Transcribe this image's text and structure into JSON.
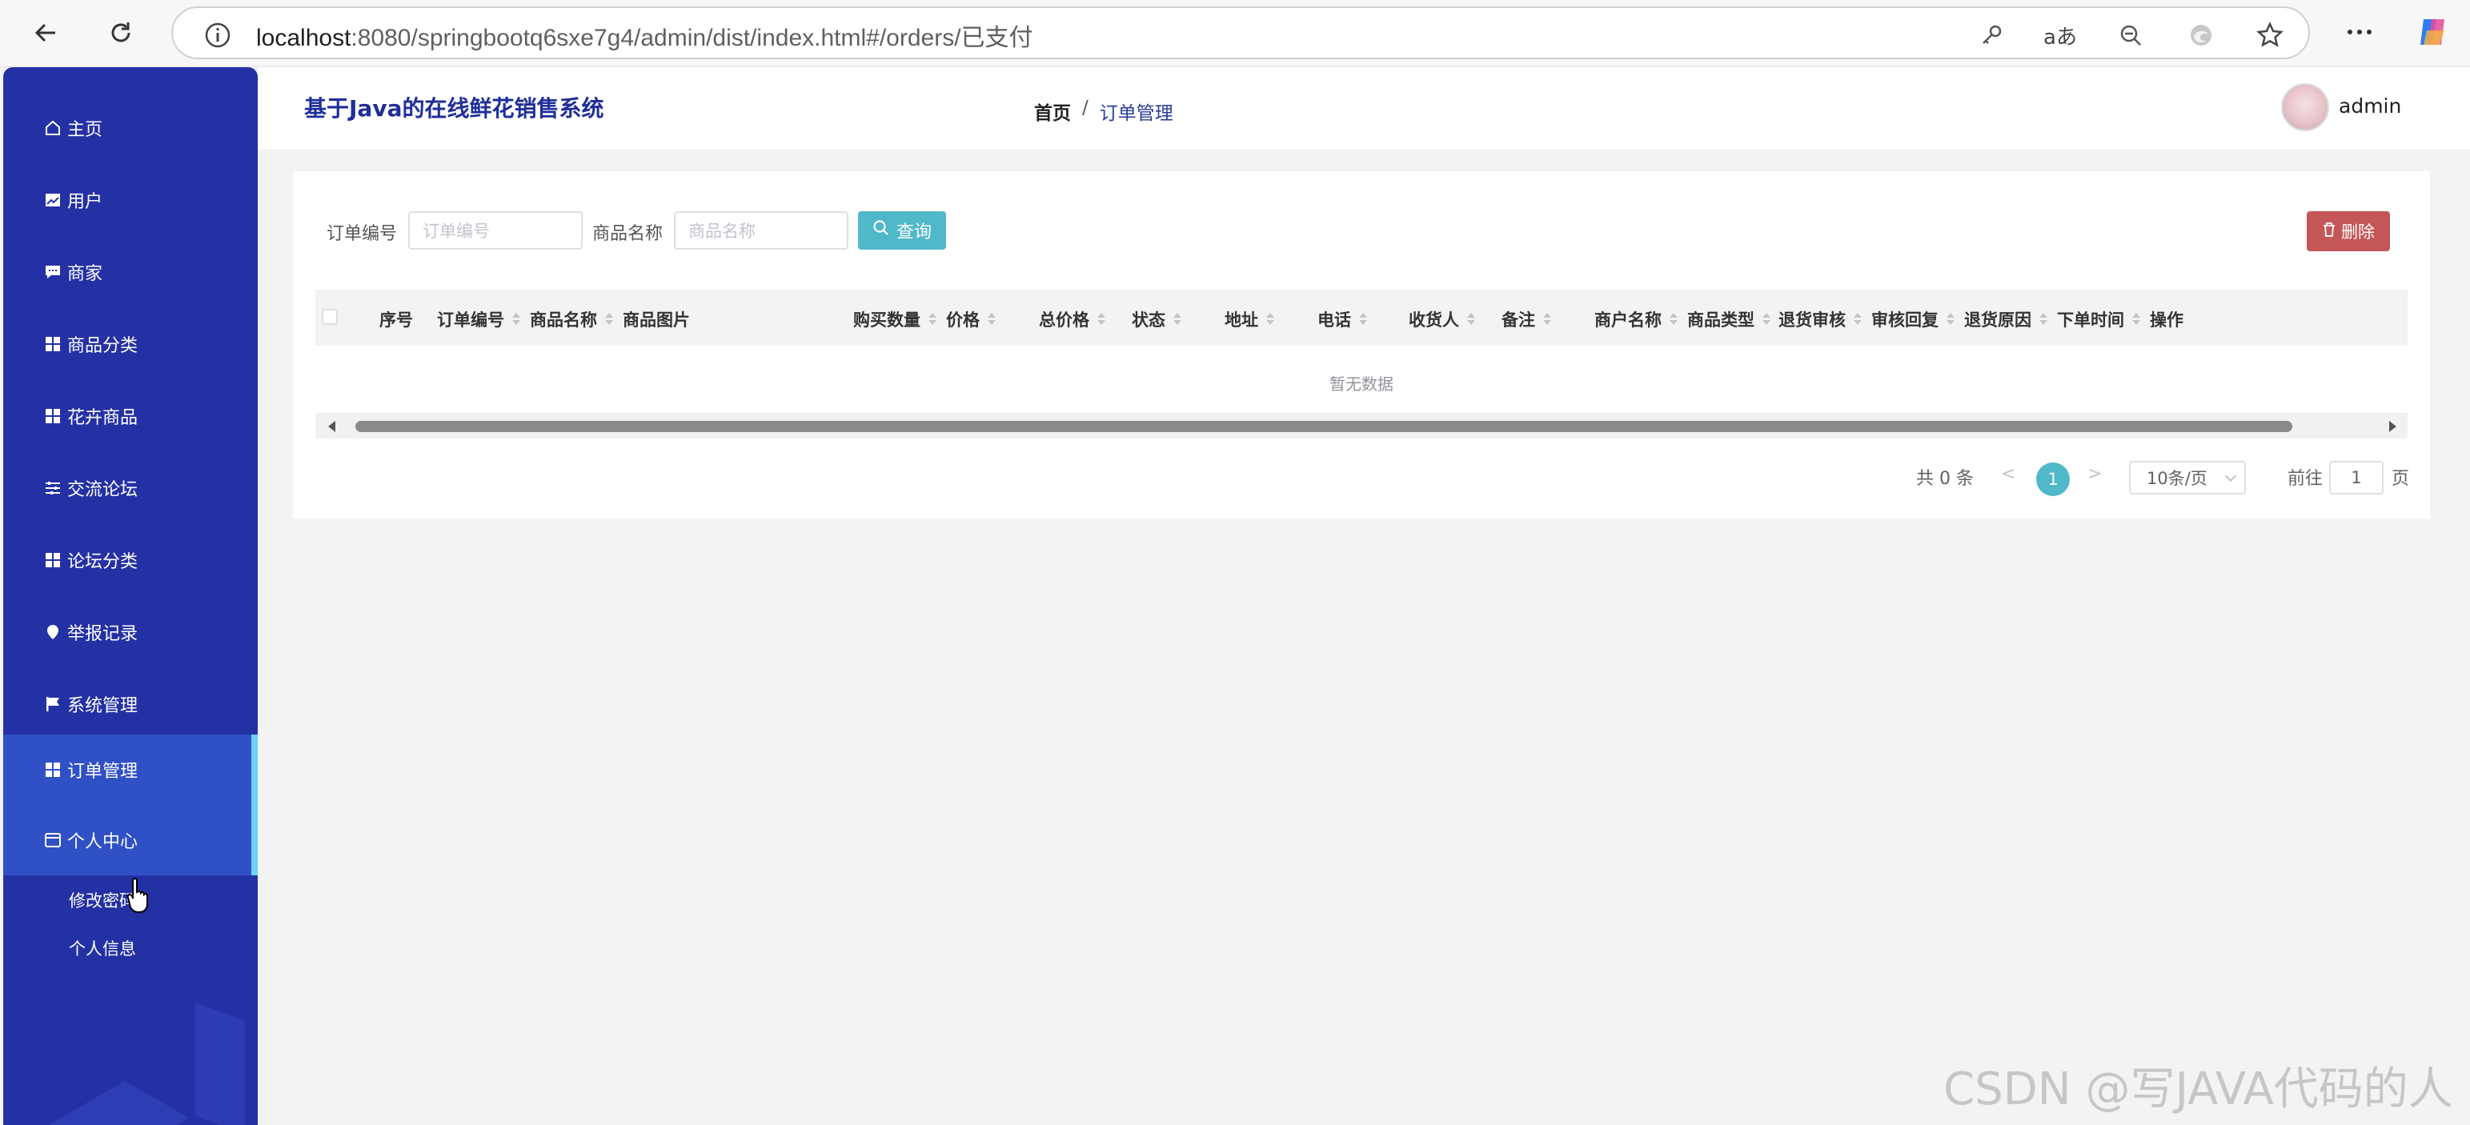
{
  "browser": {
    "url_host": "localhost",
    "url_rest": ":8080/springbootq6sxe7g4/admin/dist/index.html#/orders/已支付"
  },
  "app": {
    "title": "基于Java的在线鲜花销售系统",
    "username": "admin"
  },
  "breadcrumb": {
    "home": "首页",
    "separator": "/",
    "current": "订单管理"
  },
  "sidebar": {
    "items": [
      {
        "label": "主页",
        "icon": "home-icon"
      },
      {
        "label": "用户",
        "icon": "chart-icon"
      },
      {
        "label": "商家",
        "icon": "chat-icon"
      },
      {
        "label": "商品分类",
        "icon": "grid-icon"
      },
      {
        "label": "花卉商品",
        "icon": "grid-icon"
      },
      {
        "label": "交流论坛",
        "icon": "sliders-icon"
      },
      {
        "label": "论坛分类",
        "icon": "grid-icon"
      },
      {
        "label": "举报记录",
        "icon": "location-icon"
      },
      {
        "label": "系统管理",
        "icon": "flag-icon"
      },
      {
        "label": "订单管理",
        "icon": "grid-icon"
      },
      {
        "label": "个人中心",
        "icon": "card-icon"
      }
    ],
    "sub_items": [
      "修改密码",
      "个人信息"
    ]
  },
  "search": {
    "order_no_label": "订单编号",
    "order_no_placeholder": "订单编号",
    "product_label": "商品名称",
    "product_placeholder": "商品名称",
    "query_button": "查询",
    "delete_button": "删除"
  },
  "table": {
    "columns": [
      "序号",
      "订单编号",
      "商品名称",
      "商品图片",
      "购买数量",
      "价格",
      "总价格",
      "状态",
      "地址",
      "电话",
      "收货人",
      "备注",
      "商户名称",
      "商品类型",
      "退货审核",
      "审核回复",
      "退货原因",
      "下单时间",
      "操作"
    ],
    "empty_text": "暂无数据"
  },
  "pagination": {
    "total": "共 0 条",
    "prev": "<",
    "current_page": "1",
    "next": ">",
    "page_size": "10条/页",
    "goto_label": "前往",
    "goto_value": "1",
    "page_suffix": "页"
  },
  "watermark": "CSDN @写JAVA代码的人",
  "colors": {
    "sidebar": "#2431a5",
    "accent": "#4fb8c9",
    "danger": "#c45658",
    "title": "#1f2e9a"
  }
}
